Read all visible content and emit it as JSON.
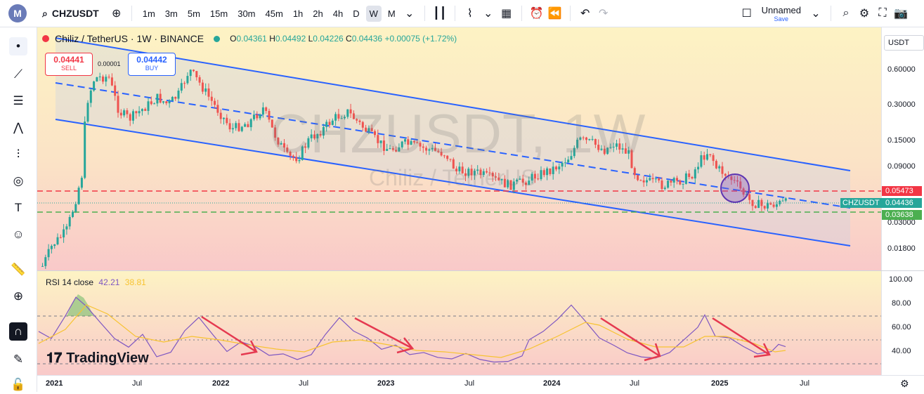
{
  "toolbar": {
    "logo": "M",
    "symbol": "CHZUSDT",
    "timeframes": [
      "1m",
      "3m",
      "5m",
      "15m",
      "30m",
      "45m",
      "1h",
      "2h",
      "4h",
      "D",
      "W",
      "M"
    ],
    "active_timeframe": "W",
    "layout_name": "Unnamed",
    "layout_sub": "Save"
  },
  "legend": {
    "title": "Chiliz / TetherUS · 1W · BINANCE",
    "o_label": "O",
    "o": "0.04361",
    "h_label": "H",
    "h": "0.04492",
    "l_label": "L",
    "l": "0.04226",
    "c_label": "C",
    "c": "0.04436",
    "change": "+0.00075 (+1.72%)"
  },
  "trade": {
    "sell_price": "0.04441",
    "sell_label": "SELL",
    "spread": "0.00001",
    "buy_price": "0.04442",
    "buy_label": "BUY"
  },
  "currency": "USDT",
  "watermark": {
    "symbol": "CHZUSDT, 1W",
    "name": "Chiliz / TetherUS"
  },
  "price_axis": [
    "0.60000",
    "0.30000",
    "0.15000",
    "0.09000",
    "0.05473",
    "0.04436",
    "0.03638",
    "0.03000",
    "0.01800"
  ],
  "price_tags": {
    "resistance": "0.05473",
    "symbol_tag": "CHZUSDT",
    "current": "0.04436",
    "support": "0.03638"
  },
  "rsi": {
    "label": "RSI 14 close",
    "value": "42.21",
    "ma_value": "38.81",
    "axis": [
      "100.00",
      "80.00",
      "60.00",
      "40.00"
    ]
  },
  "time_axis": [
    {
      "label": "2021",
      "year": true
    },
    {
      "label": "Jul",
      "year": false
    },
    {
      "label": "2022",
      "year": true
    },
    {
      "label": "Jul",
      "year": false
    },
    {
      "label": "2023",
      "year": true
    },
    {
      "label": "Jul",
      "year": false
    },
    {
      "label": "2024",
      "year": true
    },
    {
      "label": "Jul",
      "year": false
    },
    {
      "label": "2025",
      "year": true
    },
    {
      "label": "Jul",
      "year": false
    }
  ],
  "brand": "TradingView",
  "colors": {
    "up": "#26a69a",
    "down": "#ef5350",
    "channel": "#2962ff",
    "resistance": "#f23645",
    "support": "#4caf50",
    "rsi": "#7e57c2",
    "rsi_ma": "#f7c331",
    "arrow": "#e53950"
  }
}
